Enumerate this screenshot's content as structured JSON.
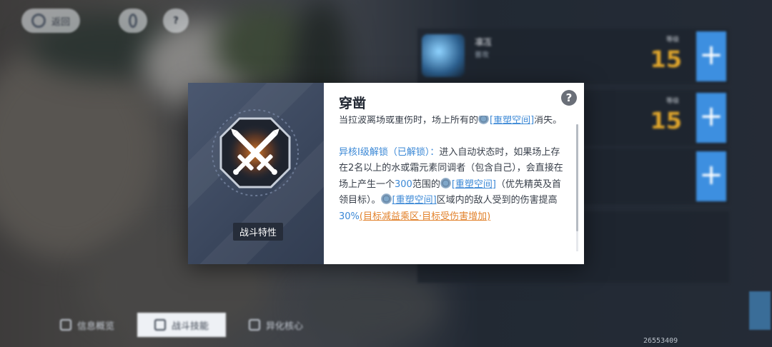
{
  "top_bar": {
    "back_label": "返回",
    "help_label": "?"
  },
  "skills": [
    {
      "name": "凛冱",
      "type": "普攻",
      "level_label": "等级",
      "level": "15",
      "add": "+"
    },
    {
      "name": "",
      "type": "",
      "level_label": "等级",
      "level": "15",
      "add": "+"
    },
    {
      "name": "",
      "type": "",
      "level_label": "",
      "level": "",
      "add": "+"
    }
  ],
  "tabs": [
    {
      "label": "信息概览"
    },
    {
      "label": "战斗技能"
    },
    {
      "label": "异化核心"
    }
  ],
  "uid": "26553409",
  "modal": {
    "category_label": "战斗特性",
    "title": "穿凿",
    "help_icon": "?",
    "top_cut_text": "当拉波离场或重伤时，场上所有的",
    "top_cut_link": "[重塑空间]",
    "top_cut_tail": "消失。",
    "unlock_label": "异核I级解锁（已解锁）：",
    "p1": "进入自动状态时，如果场上存在2名以上的水或霜元素同调者（包含自己），会直接在场上产生一个",
    "range_value": "300",
    "p2": "范围的",
    "space_link": "[重塑空间]",
    "p3": "（优先精英及首领目标）。",
    "p4": "区域内的敌人受到的伤害提高",
    "boost_value": "30%",
    "boost_note": "(目标减益乘区·目标受伤害增加)"
  },
  "colors": {
    "accent_blue": "#3b88d6",
    "level_gold": "#e0a62c",
    "note_orange": "#e2822c",
    "add_button": "#3d8fe0"
  }
}
